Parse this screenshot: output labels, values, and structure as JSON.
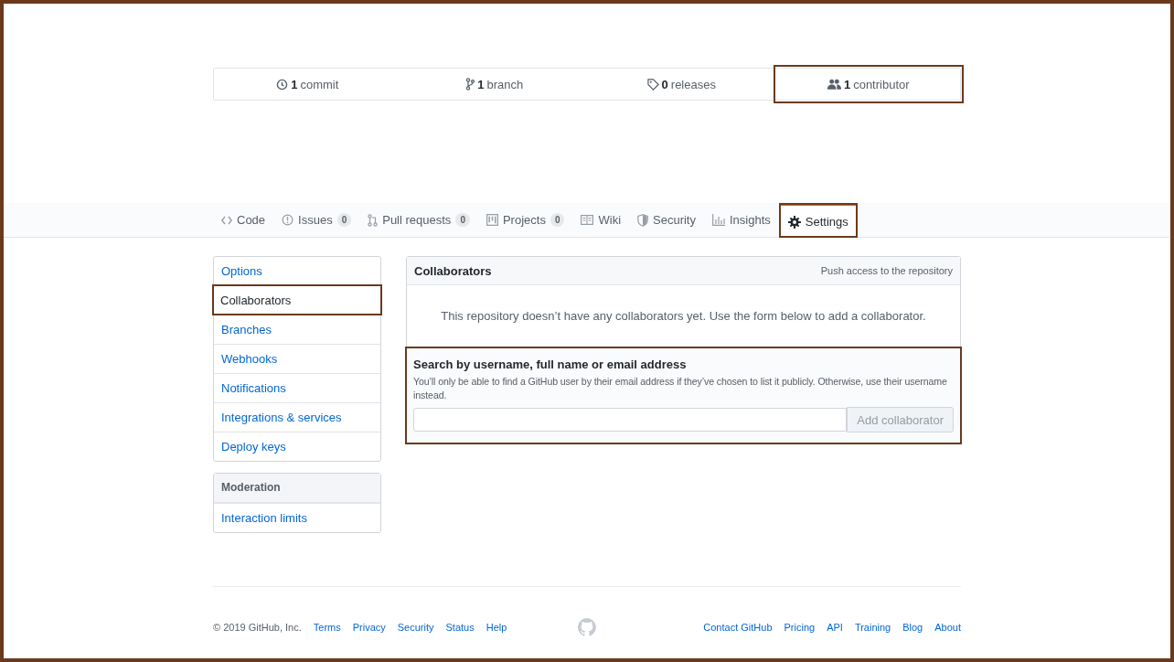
{
  "stats": [
    {
      "count": "1",
      "label": "commit",
      "highlighted": false
    },
    {
      "count": "1",
      "label": "branch",
      "highlighted": false
    },
    {
      "count": "0",
      "label": "releases",
      "highlighted": false
    },
    {
      "count": "1",
      "label": "contributor",
      "highlighted": true
    }
  ],
  "tabs": [
    {
      "label": "Code",
      "selected": false
    },
    {
      "label": "Issues",
      "counter": "0",
      "selected": false
    },
    {
      "label": "Pull requests",
      "counter": "0",
      "selected": false
    },
    {
      "label": "Projects",
      "counter": "0",
      "selected": false
    },
    {
      "label": "Wiki",
      "selected": false
    },
    {
      "label": "Security",
      "selected": false
    },
    {
      "label": "Insights",
      "selected": false
    },
    {
      "label": "Settings",
      "selected": true
    }
  ],
  "sidebar": {
    "items": [
      {
        "label": "Options",
        "selected": false
      },
      {
        "label": "Collaborators",
        "selected": true
      },
      {
        "label": "Branches",
        "selected": false
      },
      {
        "label": "Webhooks",
        "selected": false
      },
      {
        "label": "Notifications",
        "selected": false
      },
      {
        "label": "Integrations & services",
        "selected": false
      },
      {
        "label": "Deploy keys",
        "selected": false
      }
    ],
    "moderation": {
      "title": "Moderation",
      "items": [
        {
          "label": "Interaction limits",
          "selected": false
        }
      ]
    }
  },
  "panel": {
    "title": "Collaborators",
    "note": "Push access to the repository",
    "empty_message": "This repository doesn’t have any collaborators yet. Use the form below to add a collaborator.",
    "search": {
      "highlighted": true,
      "label": "Search by username, full name or email address",
      "hint": "You’ll only be able to find a GitHub user by their email address if they’ve chosen to list it publicly. Otherwise, use their username instead.",
      "button": "Add collaborator",
      "disabled": true
    }
  },
  "footer": {
    "copyright": "© 2019 GitHub, Inc.",
    "left_links": [
      "Terms",
      "Privacy",
      "Security",
      "Status",
      "Help"
    ],
    "right_links": [
      "Contact GitHub",
      "Pricing",
      "API",
      "Training",
      "Blog",
      "About"
    ]
  }
}
